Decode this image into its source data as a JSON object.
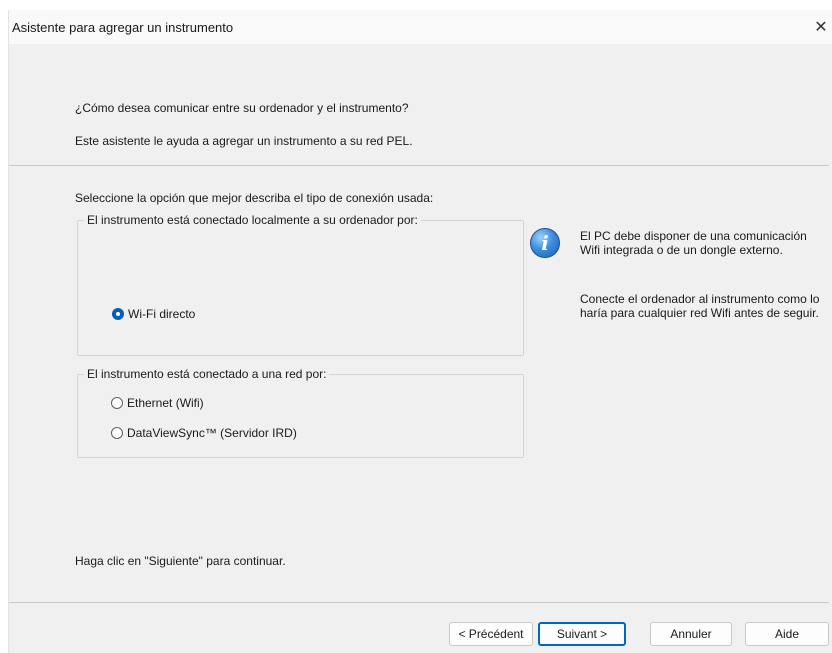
{
  "window": {
    "title": "Asistente para agregar un instrumento",
    "close_glyph": "✕"
  },
  "header": {
    "question": "¿Cómo desea comunicar entre su ordenador y el instrumento?",
    "description": "Este asistente le ayuda a agregar un instrumento a su red PEL."
  },
  "main": {
    "prompt": "Seleccione la opción que mejor describa el tipo de conexión usada:",
    "local_group": {
      "legend": "El instrumento está conectado localmente a su ordenador por:",
      "options": [
        {
          "label": "Wi-Fi directo",
          "checked": true
        }
      ]
    },
    "network_group": {
      "legend": "El instrumento está conectado a una red por:",
      "options": [
        {
          "label": "Ethernet (Wifi)",
          "checked": false
        },
        {
          "label": "DataViewSync™ (Servidor IRD)",
          "checked": false
        }
      ]
    },
    "info": {
      "icon": "info-icon",
      "icon_glyph": "i",
      "paragraph1": "El PC debe disponer de una comunicación Wifi integrada o de un dongle externo.",
      "paragraph2": "Conecte el ordenador al instrumento como lo haría para cualquier red Wifi antes de seguir."
    },
    "footer_hint": "Haga clic en \"Siguiente\" para continuar."
  },
  "buttons": {
    "back": "< Précédent",
    "next": "Suivant >",
    "cancel": "Annuler",
    "help": "Aide"
  },
  "colors": {
    "accent": "#005fb8",
    "window_bg": "#f0f0f0",
    "titlebar_bg": "#f9f9f9"
  }
}
